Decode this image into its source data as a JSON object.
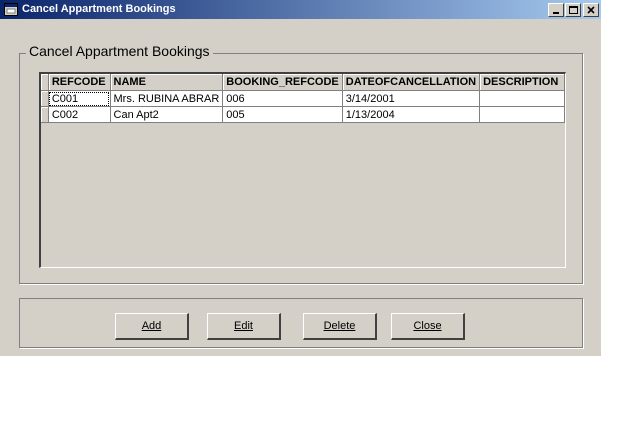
{
  "window": {
    "title": "Cancel Appartment Bookings"
  },
  "group": {
    "title": "Cancel Appartment Bookings"
  },
  "grid": {
    "columns": [
      "REFCODE",
      "NAME",
      "BOOKING_REFCODE",
      "DATEOFCANCELLATION",
      "DESCRIPTION"
    ],
    "rows": [
      [
        "C001",
        "Mrs. RUBINA ABRAR",
        "006",
        "3/14/2001",
        ""
      ],
      [
        "C002",
        "Can Apt2",
        "005",
        "1/13/2004",
        ""
      ]
    ]
  },
  "buttons": {
    "add": "Add",
    "edit": "Edit",
    "delete": "Delete",
    "close": "Close"
  },
  "icons": {
    "app": "app-window-icon",
    "minimize": "minimize-icon",
    "maximize": "maximize-icon",
    "close": "close-icon"
  },
  "colors": {
    "titlebar_start": "#0a246a",
    "titlebar_end": "#a6caf0",
    "face": "#d4d0c8"
  }
}
